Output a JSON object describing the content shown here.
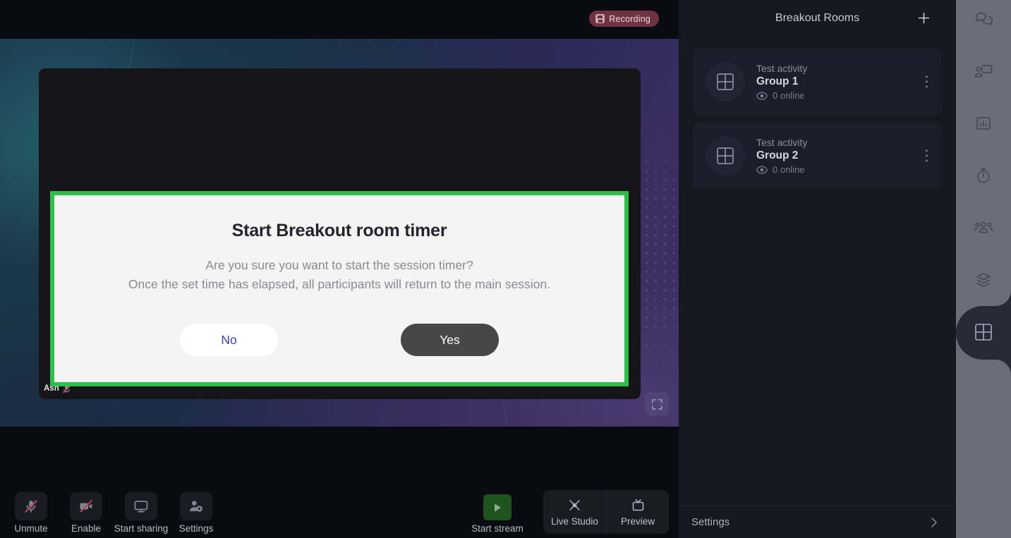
{
  "meeting": {
    "recording_badge": {
      "label": "Recording",
      "icon": "recording-disk-icon",
      "color": "#6e3240"
    },
    "tile": {
      "participant_name": "Ash",
      "mic_status_icon": "mic-off-icon",
      "fullscreen_icon": "fullscreen-icon"
    }
  },
  "dialog": {
    "title": "Start Breakout room timer",
    "line1": "Are you sure you want to start the session timer?",
    "line2": "Once the set time has elapsed, all participants will return to the main session.",
    "no_label": "No",
    "yes_label": "Yes",
    "border_color": "#2fbd4b",
    "no_text_color": "#3b3fb0",
    "yes_bg_color": "#474747"
  },
  "controls": {
    "left": [
      {
        "label": "Unmute",
        "icon": "mic-off-icon"
      },
      {
        "label": "Enable",
        "icon": "camera-off-icon"
      },
      {
        "label": "Start sharing",
        "icon": "monitor-icon"
      },
      {
        "label": "Settings",
        "icon": "person-gear-icon"
      }
    ],
    "stream": {
      "label": "Start stream",
      "icon": "play-icon",
      "color": "#20541f"
    },
    "studio": [
      {
        "label": "Live Studio",
        "icon": "scissors-icon"
      },
      {
        "label": "Preview",
        "icon": "tv-icon"
      }
    ]
  },
  "sidebar": {
    "title": "Breakout Rooms",
    "add_icon": "plus-icon",
    "rooms": [
      {
        "activity": "Test activity",
        "name": "Group 1",
        "online": "0 online",
        "icon": "grid-icon",
        "eye_icon": "eye-icon",
        "menu_icon": "kebab-menu-icon"
      },
      {
        "activity": "Test activity",
        "name": "Group 2",
        "online": "0 online",
        "icon": "grid-icon",
        "eye_icon": "eye-icon",
        "menu_icon": "kebab-menu-icon"
      }
    ],
    "settings": {
      "label": "Settings",
      "chevron_icon": "chevron-right-icon"
    }
  },
  "rail": {
    "items": [
      {
        "name": "chat",
        "icon": "chat-bubbles-icon",
        "active": false
      },
      {
        "name": "present",
        "icon": "screen-share-icon",
        "active": false
      },
      {
        "name": "polls",
        "icon": "bar-chart-icon",
        "active": false
      },
      {
        "name": "timer",
        "icon": "stopwatch-icon",
        "active": false
      },
      {
        "name": "participants",
        "icon": "people-icon",
        "active": false
      },
      {
        "name": "layers",
        "icon": "layers-icon",
        "active": false
      },
      {
        "name": "breakout-rooms",
        "icon": "grid-icon",
        "active": true
      }
    ]
  }
}
